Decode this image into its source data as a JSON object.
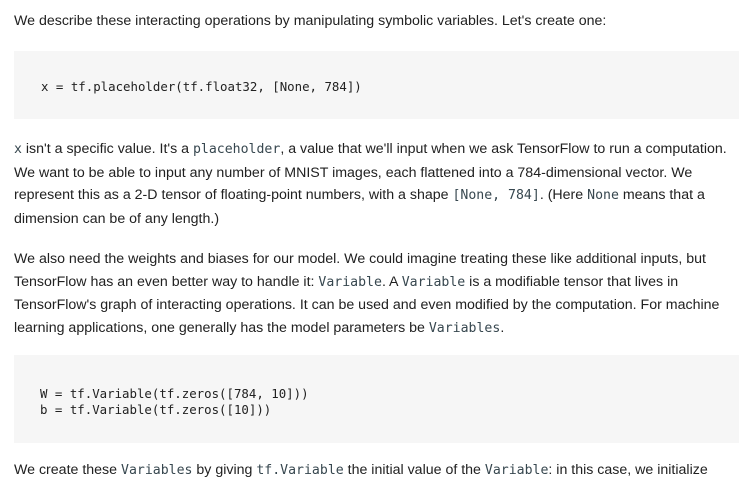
{
  "intro": "We describe these interacting operations by manipulating symbolic variables. Let's create one:",
  "code1": "x = tf.placeholder(tf.float32, [None, 784])",
  "p2": {
    "s1": "x",
    "s2": " isn't a specific value. It's a ",
    "s3": "placeholder",
    "s4": ", a value that we'll input when we ask TensorFlow to run a computation.",
    "s5": "We want to be able to input any number of MNIST images, each flattened into a 784-dimensional vector. We",
    "s6": "represent this as a 2-D tensor of floating-point numbers, with a shape ",
    "s7": "[None, 784]",
    "s8": ". (Here ",
    "s9": "None",
    "s10": " means that a",
    "s11": "dimension can be of any length.)"
  },
  "p3": {
    "l1": "We also need the weights and biases for our model. We could imagine treating these like additional inputs, but",
    "l2a": "TensorFlow has an even better way to handle it: ",
    "l2b": "Variable",
    "l2c": ". A ",
    "l2d": "Variable",
    "l2e": " is a modifiable tensor that lives in",
    "l3": "TensorFlow's graph of interacting operations. It can be used and even modified by the computation. For machine",
    "l4a": "learning applications, one generally has the model parameters be ",
    "l4b": "Variables",
    "l4c": "."
  },
  "code2": {
    "line1": "W = tf.Variable(tf.zeros([784, 10]))",
    "line2": "b = tf.Variable(tf.zeros([10]))"
  },
  "p4": {
    "a": "We create these ",
    "b": "Variables",
    "c": " by giving ",
    "d": "tf.Variable",
    "e": " the initial value of the ",
    "f": "Variable",
    "g": ": in this case, we initialize"
  }
}
